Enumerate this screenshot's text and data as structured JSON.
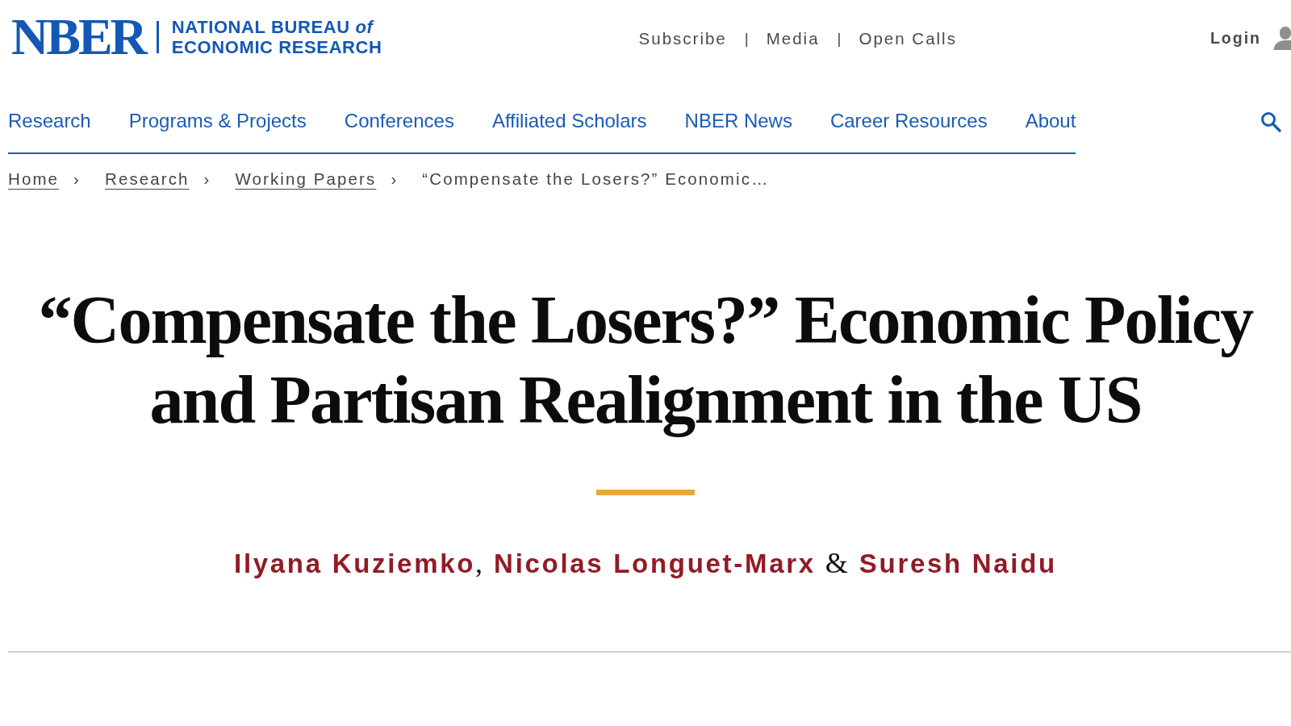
{
  "header": {
    "logo": {
      "wordmark": "NBER",
      "name_lines": [
        "NATIONAL BUREAU *of*",
        "ECONOMIC RESEARCH"
      ]
    },
    "utility_links": [
      {
        "kind": "link",
        "text": "Subscribe"
      },
      {
        "kind": "separator",
        "text": "|"
      },
      {
        "kind": "link",
        "text": "Media"
      },
      {
        "kind": "separator",
        "text": "|"
      },
      {
        "kind": "link",
        "text": "Open Calls"
      }
    ],
    "login": {
      "label": "Login"
    }
  },
  "nav": {
    "items": [
      {
        "label": "Research"
      },
      {
        "label": "Programs & Projects"
      },
      {
        "label": "Conferences"
      },
      {
        "label": "Affiliated Scholars"
      },
      {
        "label": "NBER News"
      },
      {
        "label": "Career Resources"
      },
      {
        "label": "About"
      }
    ]
  },
  "breadcrumb": [
    {
      "kind": "link",
      "text": "Home"
    },
    {
      "kind": "separator",
      "text": "›"
    },
    {
      "kind": "link",
      "text": "Research"
    },
    {
      "kind": "separator",
      "text": "›"
    },
    {
      "kind": "link",
      "text": "Working Papers"
    },
    {
      "kind": "separator",
      "text": "›"
    },
    {
      "kind": "current",
      "text": "“Compensate the Losers?” Economic…"
    }
  ],
  "article": {
    "title_lines": [
      "“Compensate the Losers?” Economic Policy",
      "and Partisan Realignment in the US"
    ],
    "authors": [
      {
        "kind": "author",
        "text": "Ilyana Kuziemko"
      },
      {
        "kind": "joiner",
        "text": ","
      },
      {
        "kind": "author",
        "text": "Nicolas Longuet-Marx"
      },
      {
        "kind": "joiner",
        "text": "&"
      },
      {
        "kind": "author",
        "text": "Suresh Naidu"
      }
    ]
  }
}
